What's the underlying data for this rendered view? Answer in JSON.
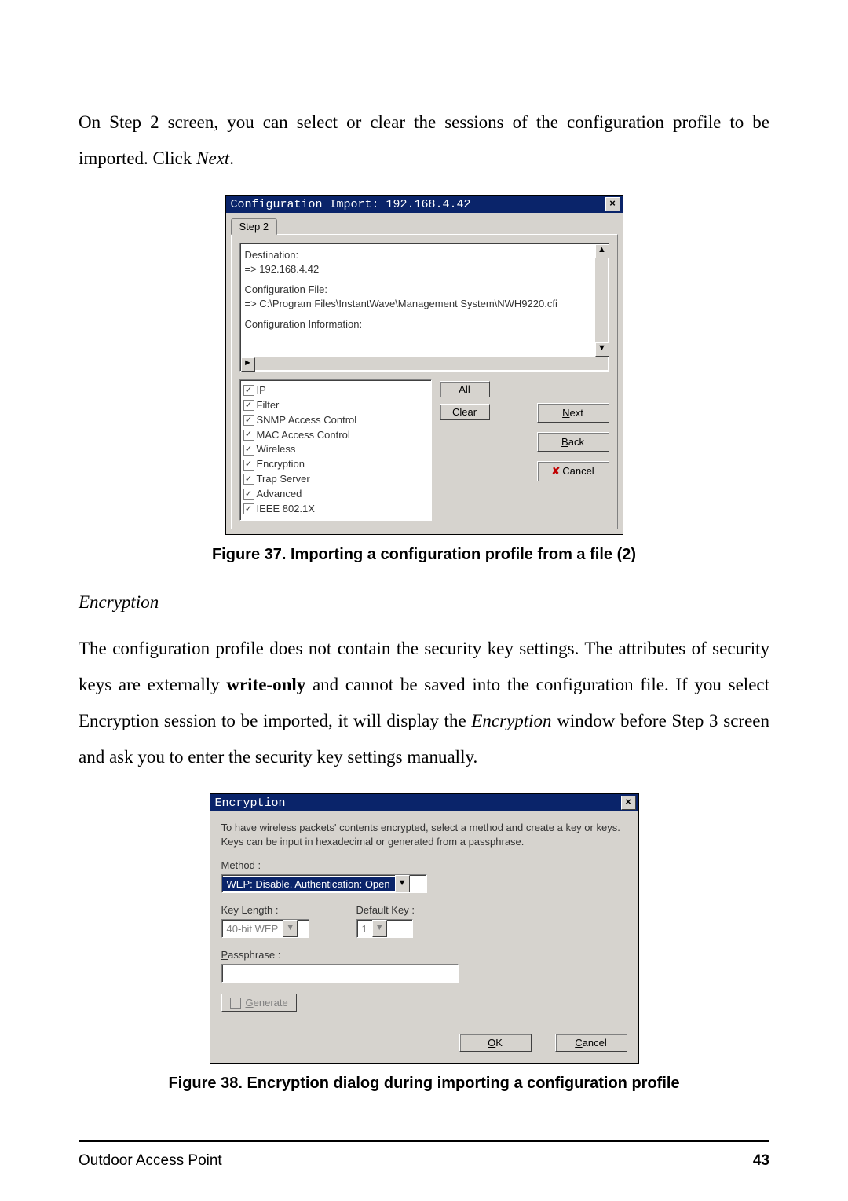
{
  "intro": {
    "line": "On Step 2 screen, you can select or clear the sessions of the configuration profile to be imported. Click ",
    "click": "Next",
    "period": "."
  },
  "dlg1": {
    "title": "Configuration Import: 192.168.4.42",
    "tab": "Step 2",
    "dest_label": "Destination:",
    "dest_val": "=> 192.168.4.42",
    "cfgfile_label": "Configuration File:",
    "cfgfile_val": "=> C:\\Program Files\\InstantWave\\Management System\\NWH9220.cfi",
    "cfginfo_label": "Configuration Information:",
    "checks": [
      "IP",
      "Filter",
      "SNMP Access Control",
      "MAC Access Control",
      "Wireless",
      "Encryption",
      "Trap Server",
      "Advanced",
      "IEEE 802.1X"
    ],
    "btn_all": "All",
    "btn_clear": "Clear",
    "btn_next_u": "N",
    "btn_next_r": "ext",
    "btn_back_u": "B",
    "btn_back_r": "ack",
    "btn_cancel": "Cancel"
  },
  "fig37": "Figure 37.  Importing a configuration profile from a file (2)",
  "encryption_title": "Encryption",
  "para2": {
    "a": "The configuration profile does not contain the security key settings. The attributes of security keys are externally ",
    "b": "write-only",
    "c": " and cannot be saved into the configuration file. If you select Encryption session to be imported, it will display the ",
    "d": "Encryption",
    "e": " window before Step 3 screen and ask you to enter the security key settings manually."
  },
  "dlg2": {
    "title": "Encryption",
    "desc": "To have wireless packets' contents encrypted, select a method and create a key or keys. Keys can be input in hexadecimal or generated from a passphrase.",
    "method_label": "Method :",
    "method_value": "WEP: Disable, Authentication: Open",
    "keylen_label": "Key Length :",
    "keylen_value": "40-bit WEP",
    "defkey_label": "Default Key :",
    "defkey_value": "1",
    "pass_label_u": "P",
    "pass_label_r": "assphrase :",
    "gen_u": "G",
    "gen_r": "enerate",
    "ok_u": "O",
    "ok_r": "K",
    "cancel_u": "C",
    "cancel_r": "ancel"
  },
  "fig38": "Figure 38.  Encryption dialog during importing a configuration profile",
  "footer": {
    "left": "Outdoor Access Point",
    "right": "43"
  }
}
